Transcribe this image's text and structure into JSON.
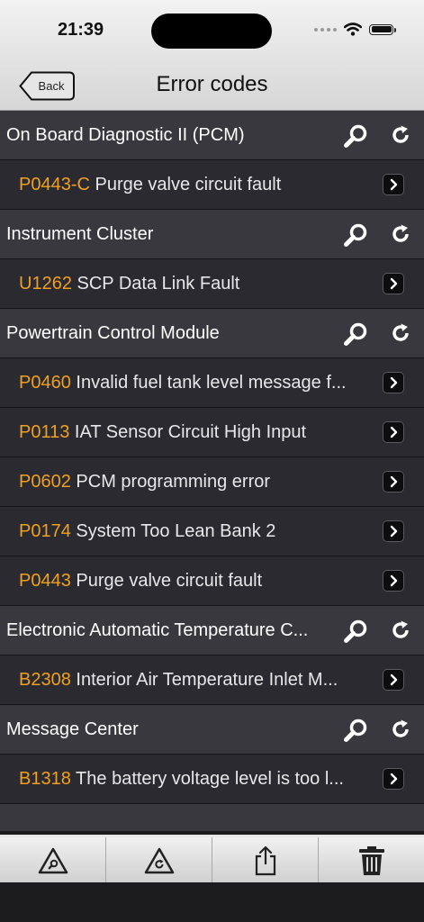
{
  "status_bar": {
    "time": "21:39"
  },
  "nav": {
    "back_label": "Back",
    "title": "Error codes"
  },
  "sections": [
    {
      "title": "On Board Diagnostic II (PCM)",
      "items": [
        {
          "code": "P0443-C",
          "desc": "Purge valve circuit fault"
        }
      ]
    },
    {
      "title": "Instrument Cluster",
      "items": [
        {
          "code": "U1262",
          "desc": "SCP Data Link Fault"
        }
      ]
    },
    {
      "title": "Powertrain Control Module",
      "items": [
        {
          "code": "P0460",
          "desc": "Invalid fuel tank level message f..."
        },
        {
          "code": "P0113",
          "desc": "IAT Sensor Circuit High Input"
        },
        {
          "code": "P0602",
          "desc": "PCM programming error"
        },
        {
          "code": "P0174",
          "desc": "System Too Lean Bank 2"
        },
        {
          "code": "P0443",
          "desc": "Purge valve circuit fault"
        }
      ]
    },
    {
      "title": "Electronic Automatic Temperature C...",
      "items": [
        {
          "code": "B2308",
          "desc": "Interior Air Temperature Inlet M..."
        }
      ]
    },
    {
      "title": "Message Center",
      "items": [
        {
          "code": "B1318",
          "desc": "The battery voltage level is too l..."
        }
      ]
    }
  ],
  "section_icons": {
    "search": "search-icon",
    "refresh": "refresh-icon"
  },
  "item_icon": "chevron-right-icon",
  "toolbar": {
    "buttons": [
      {
        "icon": "warning-triangle-search-icon"
      },
      {
        "icon": "warning-triangle-refresh-icon"
      },
      {
        "icon": "share-icon"
      },
      {
        "icon": "trash-icon"
      }
    ]
  },
  "colors": {
    "code": "#f0a020",
    "section_bg": "#38383e",
    "item_bg": "#2a2a30"
  }
}
